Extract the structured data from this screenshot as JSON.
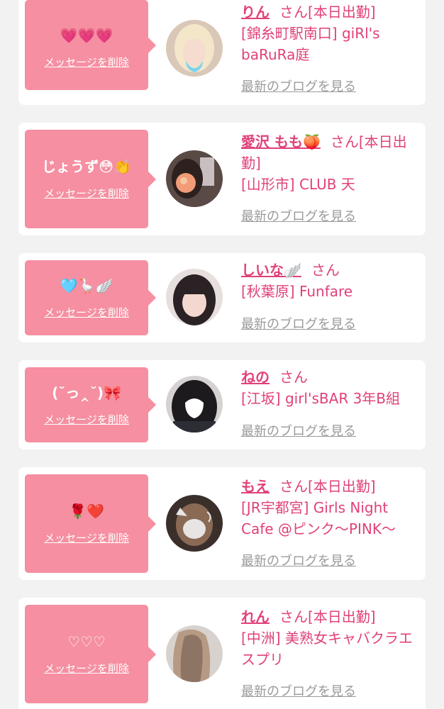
{
  "entries": [
    {
      "message": "💗💗💗",
      "delete_label": "メッセージを削除",
      "name": "りん",
      "suffix": "さん[本日出勤]",
      "shop": "[錦糸町駅南口] giRl's baRuRa庭",
      "blog_label": "最新のブログを見る",
      "avatar_icon": "profile-photo"
    },
    {
      "message": "じょうず😳👏",
      "delete_label": "メッセージを削除",
      "name": "愛沢 もも🍑",
      "suffix": "さん[本日出勤]",
      "shop": "[山形市] CLUB 天",
      "blog_label": "最新のブログを見る",
      "avatar_icon": "profile-photo"
    },
    {
      "message": "🩵🪿🪽",
      "delete_label": "メッセージを削除",
      "name": "しいな🪽",
      "suffix": "さん",
      "shop": "[秋葉原] Funfare",
      "blog_label": "最新のブログを見る",
      "avatar_icon": "profile-photo"
    },
    {
      "message": "(˘っ‸˘)🎀",
      "delete_label": "メッセージを削除",
      "name": "ねの",
      "suffix": "さん",
      "shop": "[江坂] girl'sBAR 3年B組",
      "blog_label": "最新のブログを見る",
      "avatar_icon": "profile-photo"
    },
    {
      "message": "🌹❤️",
      "delete_label": "メッセージを削除",
      "name": "もえ",
      "suffix": "さん[本日出勤]",
      "shop": "[JR宇都宮] Girls Night Cafe @ピンク〜PINK〜",
      "blog_label": "最新のブログを見る",
      "avatar_icon": "profile-photo"
    },
    {
      "message": "♡♡♡",
      "delete_label": "メッセージを削除",
      "name": "れん",
      "suffix": "さん[本日出勤]",
      "shop": "[中洲] 美熟女キャバクラエスプリ",
      "blog_label": "最新のブログを見る",
      "avatar_icon": "profile-photo"
    }
  ],
  "colors": {
    "background": "#f2f2f2",
    "card": "#ffffff",
    "bubble": "#f58fa1",
    "accent_text": "#e0417a",
    "link_gray": "#9a9a9a"
  }
}
